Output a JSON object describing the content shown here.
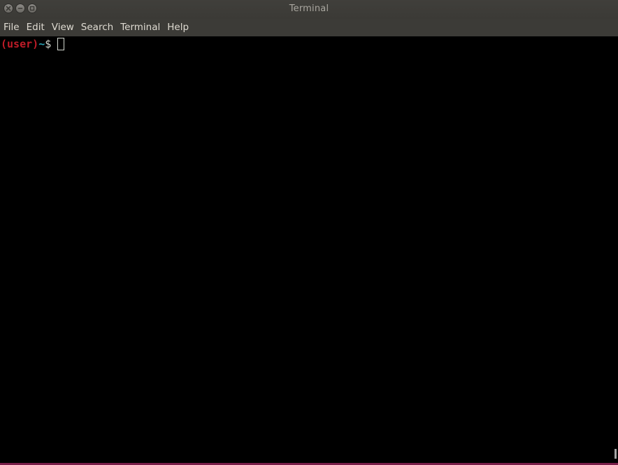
{
  "window": {
    "title": "Terminal",
    "controls": [
      {
        "name": "close-icon"
      },
      {
        "name": "minimize-icon"
      },
      {
        "name": "maximize-icon"
      }
    ]
  },
  "menubar": {
    "items": [
      "File",
      "Edit",
      "View",
      "Search",
      "Terminal",
      "Help"
    ]
  },
  "terminal": {
    "prompt_user": "(user)",
    "prompt_path": "~",
    "prompt_symbol": "$",
    "colors": {
      "user": "#c01c28",
      "path": "#2aa1b3",
      "text": "#d3d7cf",
      "background": "#000000"
    }
  }
}
